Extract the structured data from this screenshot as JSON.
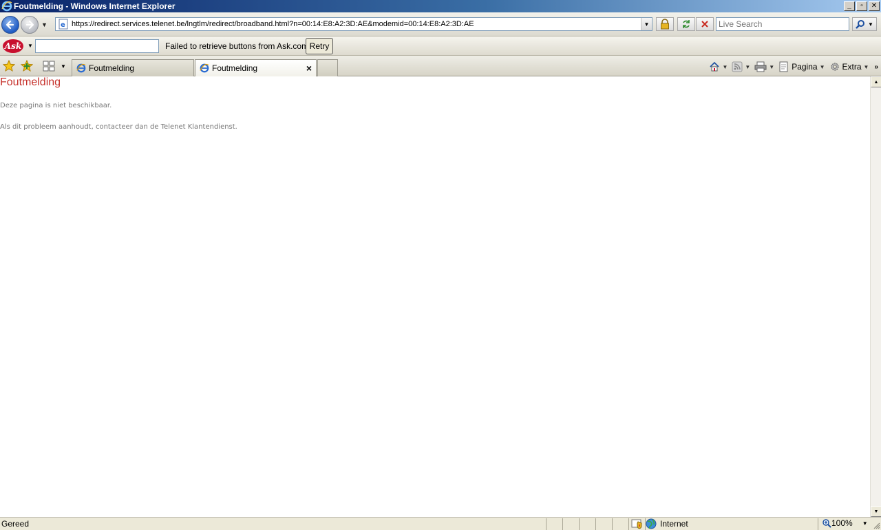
{
  "window": {
    "title": "Foutmelding - Windows Internet Explorer",
    "controls": {
      "minimize": "_",
      "maximize": "▫",
      "close": "✕"
    }
  },
  "address_bar": {
    "url": "https://redirect.services.telenet.be/lngtlm/redirect/broadband.html?n=00:14:E8:A2:3D:AE&modemid=00:14:E8:A2:3D:AE",
    "search_placeholder": "Live Search"
  },
  "ask_toolbar": {
    "logo": "Ask",
    "search_value": "",
    "message": "Failed to retrieve buttons from Ask.com.",
    "retry_label": "Retry"
  },
  "tabs": [
    {
      "label": "Foutmelding",
      "active": false
    },
    {
      "label": "Foutmelding",
      "active": true
    }
  ],
  "command_bar": {
    "page_label": "Pagina",
    "tools_label": "Extra",
    "more": "»"
  },
  "content": {
    "title": "Foutmelding",
    "line1": "Deze pagina is niet beschikbaar.",
    "line2": "Als dit probleem aanhoudt, contacteer dan de Telenet Klantendienst."
  },
  "status_bar": {
    "status": "Gereed",
    "zone": "Internet",
    "zoom": "100%"
  },
  "colors": {
    "title_text": "#c6312b",
    "body_text": "#777777",
    "titlebar_start": "#0a246a",
    "titlebar_end": "#a6caf0"
  }
}
